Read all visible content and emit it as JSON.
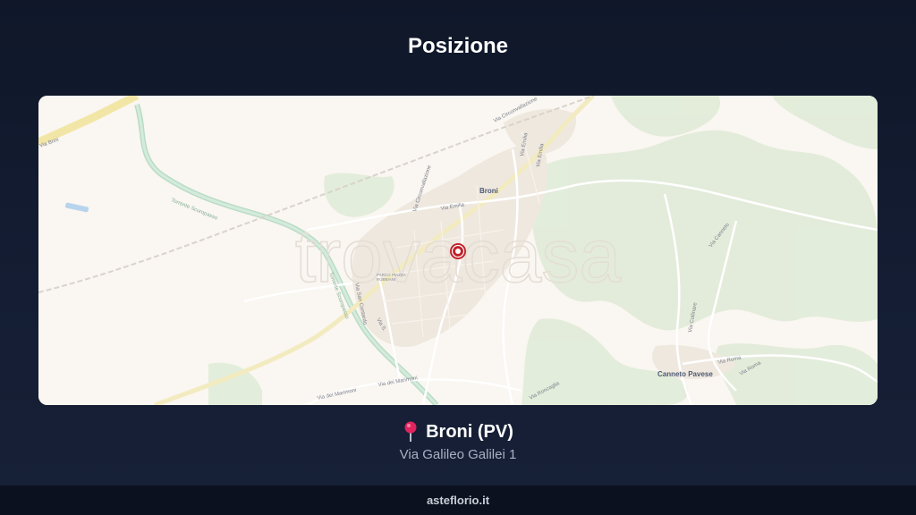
{
  "page": {
    "title": "Posizione"
  },
  "map": {
    "watermark": "trovacasa",
    "labels": {
      "town_main": "Broni",
      "town_secondary": "Canneto Pavese",
      "park": "PARCO PIAZZA\nRUBBIANI",
      "streets": {
        "circonvallazione_n": "Via Circonvallazione",
        "circonvallazione_v": "Via Circonvallazione",
        "emilia": "Via Emilia",
        "emilia_2": "Via Emilia",
        "emilia_3": "Via Emilia",
        "san_contardo": "Via San Contardo",
        "via_s": "Via S.",
        "marimoni_1": "Via dei Marimoni",
        "marimoni_2": "Via dei Marimoni",
        "roma": "Via Roma",
        "roma_2": "Via Roma",
        "canneto": "Via Canneto",
        "torrente_scuropasso": "Torrente Scuropasso",
        "torrente_2": "Torrente Scuropasso",
        "roncaglia": "Via Roncaglia",
        "brini": "Via Brini",
        "collinare": "Via Collinare"
      }
    },
    "marker": {
      "icon": "location-marker-icon",
      "color": "#c0202a"
    }
  },
  "location": {
    "icon": "round-pushpin-icon",
    "city": "Broni (PV)",
    "address": "Via Galileo Galilei 1"
  },
  "footer": {
    "site": "asteflorio.it"
  }
}
